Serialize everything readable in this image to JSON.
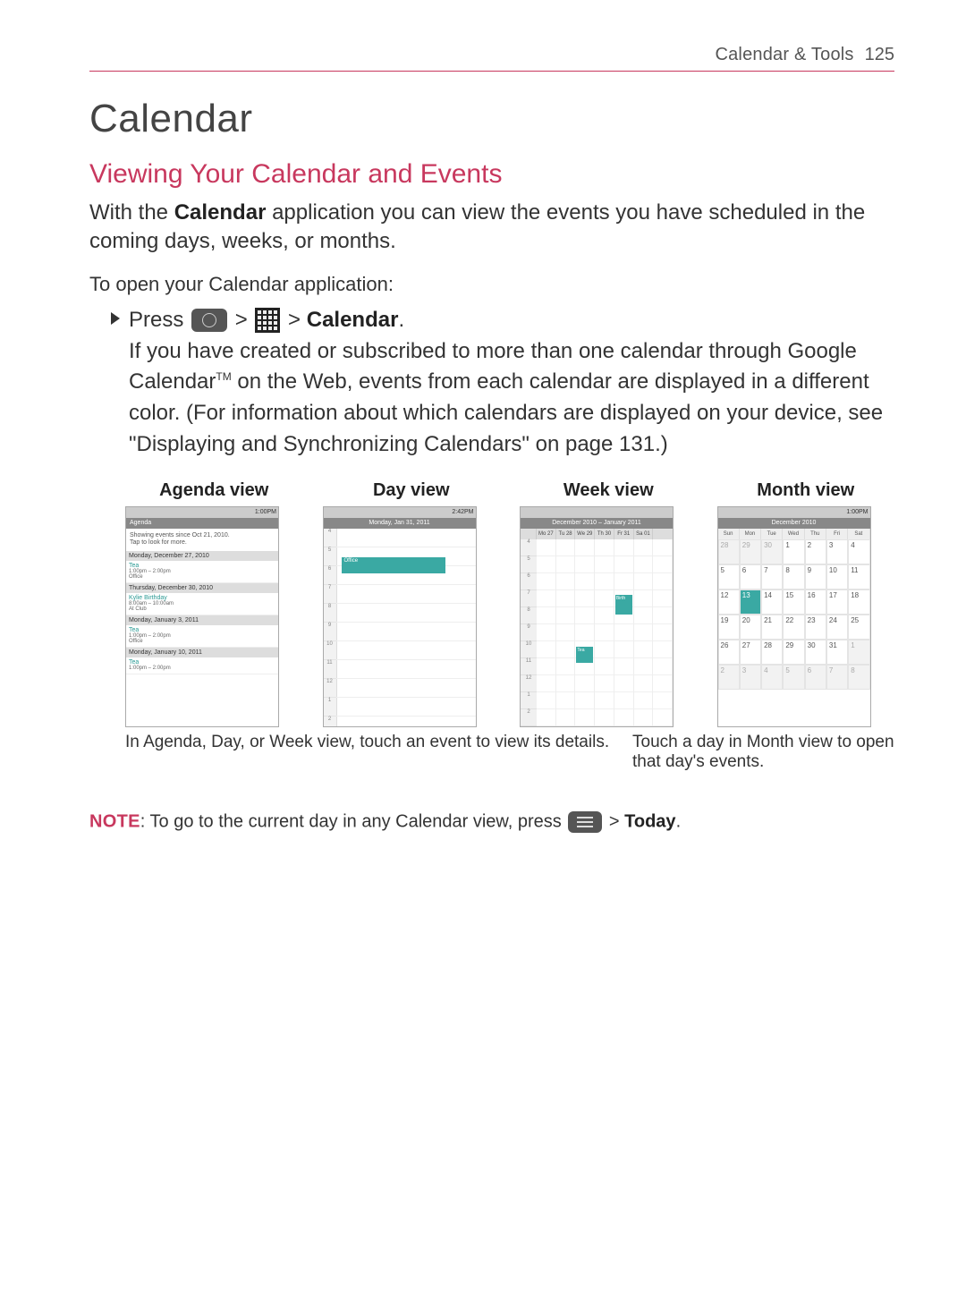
{
  "header": {
    "breadcrumb": "Calendar & Tools",
    "page": "125"
  },
  "title": "Calendar",
  "section_title": "Viewing Your Calendar and Events",
  "intro_pre": "With the ",
  "intro_bold": "Calendar",
  "intro_post": " application you can view the events you have scheduled in the coming days, weeks, or months.",
  "open_heading": "To open your Calendar application:",
  "step_press": "Press ",
  "step_sep": " > ",
  "step_calendar": "Calendar",
  "step_period": ".",
  "step_body": "If you have created or subscribed to more than one calendar through Google Calendar",
  "step_tm": "TM",
  "step_body2": " on the Web, events from each calendar are displayed in a different color. (For information about which calendars are displayed on your device, see \"Displaying and Synchronizing Calendars\" on page 131.)",
  "views": {
    "agenda": {
      "label": "Agenda view",
      "status_time": "1:00PM",
      "topbar": "Agenda",
      "hint1": "Showing events since Oct 21, 2010.",
      "hint2": "Tap to look for more.",
      "sections": [
        {
          "hdr": "Monday, December 27, 2010",
          "title": "Tea",
          "det": "1:00pm – 2:00pm",
          "loc": "Office"
        },
        {
          "hdr": "Thursday, December 30, 2010",
          "title": "Kylie Birthday",
          "det": "8:00am – 10:00am",
          "loc": "At Club"
        },
        {
          "hdr": "Monday, January 3, 2011",
          "title": "Tea",
          "det": "1:00pm – 2:00pm",
          "loc": "Office"
        },
        {
          "hdr": "Monday, January 10, 2011",
          "title": "Tea",
          "det": "1:00pm – 2:00pm",
          "loc": ""
        }
      ]
    },
    "day": {
      "label": "Day view",
      "status_time": "2:42PM",
      "topbar": "Monday, Jan 31, 2011",
      "event": "Office"
    },
    "week": {
      "label": "Week view",
      "topbar": "December 2010 – January 2011",
      "cols": [
        "",
        "Mo 27",
        "Tu 28",
        "We 29",
        "Th 30",
        "Fr 31",
        "Sa 01"
      ],
      "ev1": "Birth",
      "ev2": "Tea"
    },
    "month": {
      "label": "Month view",
      "status_time": "1:00PM",
      "topbar": "December 2010",
      "dow": [
        "Sun",
        "Mon",
        "Tue",
        "Wed",
        "Thu",
        "Fri",
        "Sat"
      ],
      "cells": [
        {
          "n": "28",
          "dim": true
        },
        {
          "n": "29",
          "dim": true
        },
        {
          "n": "30",
          "dim": true
        },
        {
          "n": "1"
        },
        {
          "n": "2"
        },
        {
          "n": "3"
        },
        {
          "n": "4"
        },
        {
          "n": "5"
        },
        {
          "n": "6"
        },
        {
          "n": "7"
        },
        {
          "n": "8"
        },
        {
          "n": "9"
        },
        {
          "n": "10"
        },
        {
          "n": "11"
        },
        {
          "n": "12"
        },
        {
          "n": "13",
          "hl": true
        },
        {
          "n": "14"
        },
        {
          "n": "15"
        },
        {
          "n": "16"
        },
        {
          "n": "17"
        },
        {
          "n": "18"
        },
        {
          "n": "19"
        },
        {
          "n": "20"
        },
        {
          "n": "21"
        },
        {
          "n": "22"
        },
        {
          "n": "23"
        },
        {
          "n": "24"
        },
        {
          "n": "25"
        },
        {
          "n": "26"
        },
        {
          "n": "27"
        },
        {
          "n": "28"
        },
        {
          "n": "29"
        },
        {
          "n": "30"
        },
        {
          "n": "31"
        },
        {
          "n": "1",
          "dim": true
        },
        {
          "n": "2",
          "dim": true
        },
        {
          "n": "3",
          "dim": true
        },
        {
          "n": "4",
          "dim": true
        },
        {
          "n": "5",
          "dim": true
        },
        {
          "n": "6",
          "dim": true
        },
        {
          "n": "7",
          "dim": true
        },
        {
          "n": "8",
          "dim": true
        }
      ]
    }
  },
  "caption_left": "In Agenda, Day, or Week view, touch an event to view its details.",
  "caption_right": "Touch a day in Month view to open that day's events.",
  "note_label": "NOTE",
  "note_text_pre": ": To go to the current day in any Calendar view, press ",
  "note_sep": " > ",
  "note_today": "Today",
  "note_period": "."
}
